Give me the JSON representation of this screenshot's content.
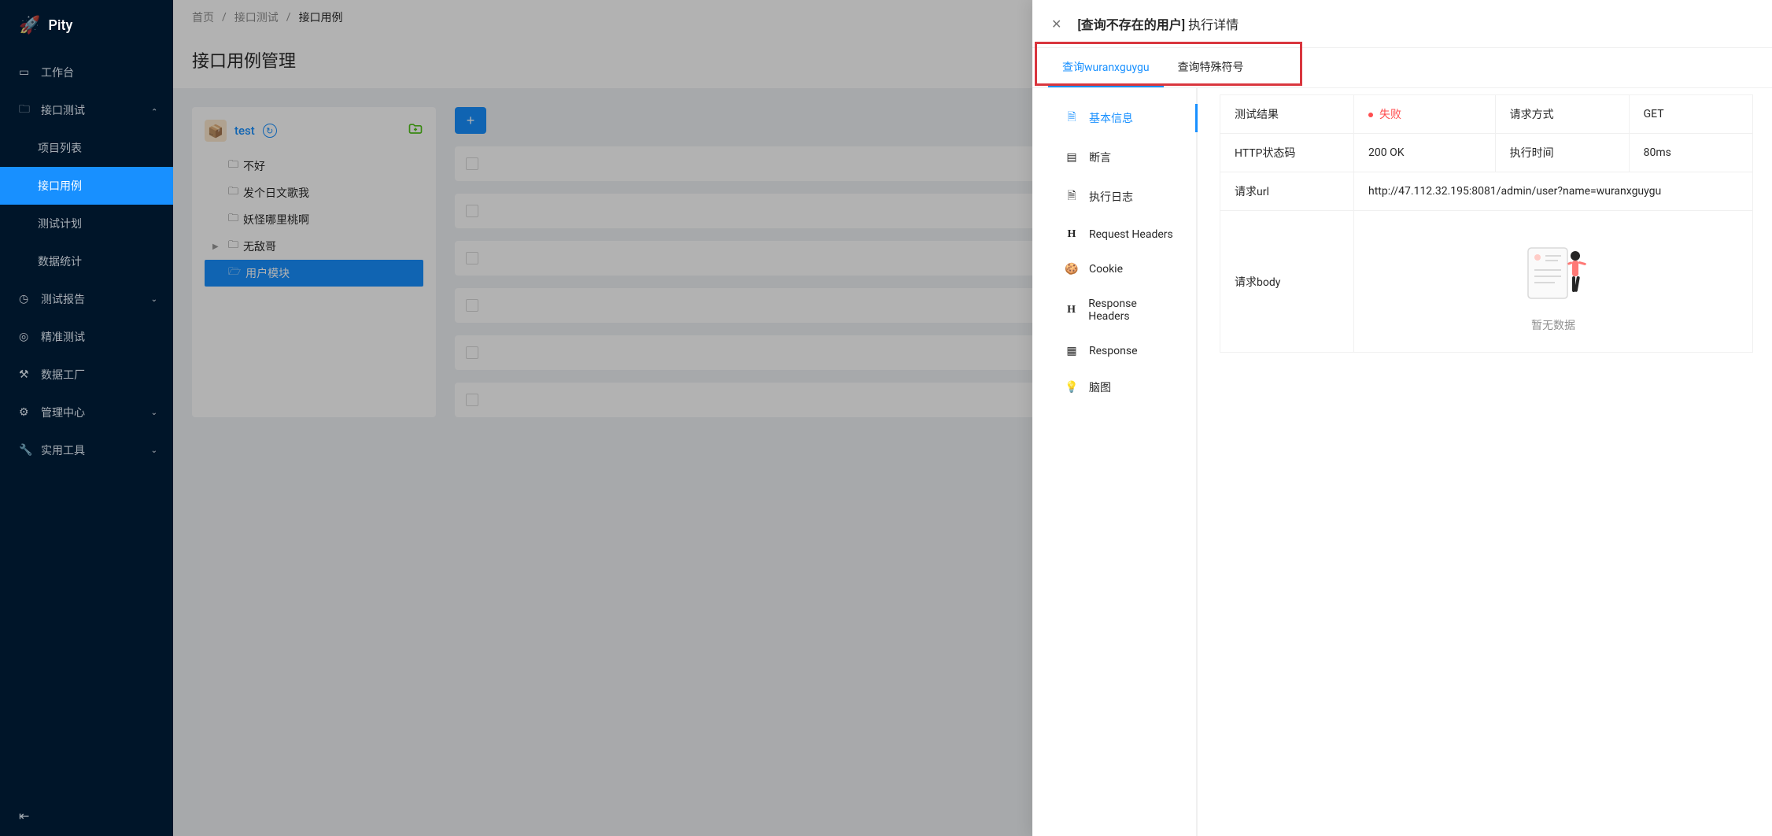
{
  "app": {
    "name": "Pity"
  },
  "sidebar": {
    "items": [
      {
        "label": "工作台",
        "icon": "dashboard"
      },
      {
        "label": "接口测试",
        "icon": "folder",
        "expanded": true,
        "children": [
          {
            "label": "项目列表"
          },
          {
            "label": "接口用例",
            "active": true
          },
          {
            "label": "测试计划"
          },
          {
            "label": "数据统计"
          }
        ]
      },
      {
        "label": "测试报告",
        "icon": "clock",
        "expandable": true
      },
      {
        "label": "精准测试",
        "icon": "target"
      },
      {
        "label": "数据工厂",
        "icon": "factory"
      },
      {
        "label": "管理中心",
        "icon": "settings",
        "expandable": true
      },
      {
        "label": "实用工具",
        "icon": "wrench",
        "expandable": true
      }
    ]
  },
  "breadcrumb": {
    "items": [
      "首页",
      "接口测试",
      "接口用例"
    ]
  },
  "page": {
    "title": "接口用例管理"
  },
  "project": {
    "name": "test",
    "tree": [
      {
        "label": "不好"
      },
      {
        "label": "发个日文歌我"
      },
      {
        "label": "妖怪哪里桃啊"
      },
      {
        "label": "无敌哥",
        "hasChildren": true
      },
      {
        "label": "用户模块",
        "selected": true
      }
    ]
  },
  "drawer": {
    "title_bracket": "[查询不存在的用户]",
    "title_rest": " 执行详情",
    "tabs": [
      {
        "label": "查询wuranxguygu",
        "active": true
      },
      {
        "label": "查询特殊符号"
      }
    ],
    "sideNav": [
      {
        "label": "基本信息",
        "icon": "file",
        "active": true
      },
      {
        "label": "断言",
        "icon": "assert"
      },
      {
        "label": "执行日志",
        "icon": "log"
      },
      {
        "label": "Request Headers",
        "icon": "H"
      },
      {
        "label": "Cookie",
        "icon": "cookie"
      },
      {
        "label": "Response Headers",
        "icon": "H"
      },
      {
        "label": "Response",
        "icon": "response"
      },
      {
        "label": "脑图",
        "icon": "mindmap"
      }
    ],
    "details": {
      "row1": {
        "label1": "测试结果",
        "value1": "失败",
        "label2": "请求方式",
        "value2": "GET"
      },
      "row2": {
        "label1": "HTTP状态码",
        "value1": "200 OK",
        "label2": "执行时间",
        "value2": "80ms"
      },
      "url_label": "请求url",
      "url_value": "http://47.112.32.195:8081/admin/user?name=wuranxguygu",
      "body_label": "请求body",
      "empty_text": "暂无数据"
    }
  }
}
